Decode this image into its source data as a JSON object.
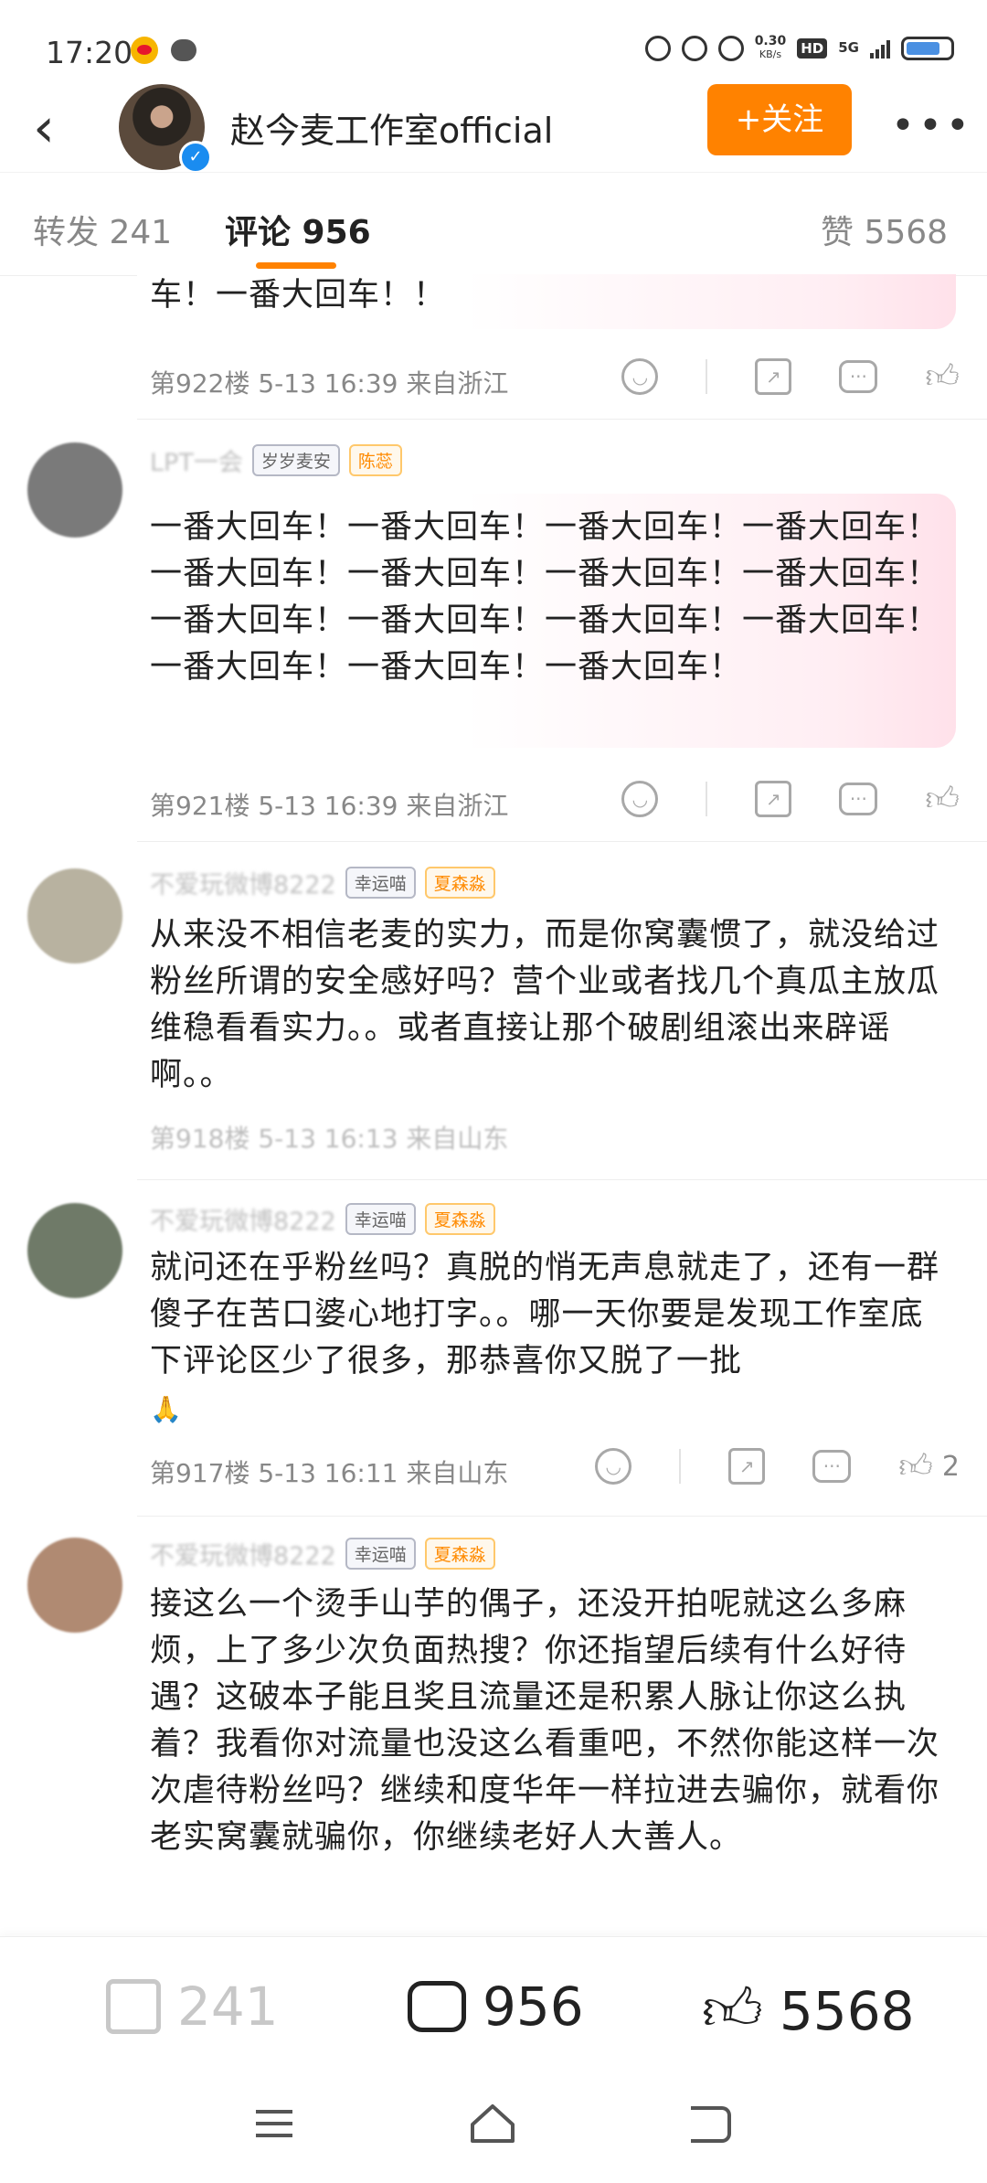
{
  "status_bar": {
    "time": "17:20",
    "net_speed_value": "0.30",
    "net_speed_unit": "KB/s",
    "hd": "HD",
    "network": "5G"
  },
  "header": {
    "back_icon": "chevron-left-icon",
    "title": "赵今麦工作室official",
    "follow_label": "+关注",
    "more_label": "•••"
  },
  "tabs": {
    "repost": "转发 241",
    "comments": "评论 956",
    "likes": "赞 5568"
  },
  "comments": [
    {
      "text": "车！一番大回车！！",
      "meta": "第922楼 5-13 16:39 来自浙江"
    },
    {
      "name": "LPT一会",
      "badge1": "岁岁麦安",
      "badge2": "陈蕊",
      "text": "一番大回车！一番大回车！一番大回车！一番大回车！一番大回车！一番大回车！一番大回车！一番大回车！一番大回车！一番大回车！一番大回车！一番大回车！一番大回车！一番大回车！一番大回车！",
      "meta": "第921楼 5-13 16:39 来自浙江"
    },
    {
      "name": "不爱玩微博8222",
      "badge1": "幸运喵",
      "badge2": "夏森淼",
      "text": "从来没不相信老麦的实力，而是你窝囊惯了，就没给过粉丝所谓的安全感好吗？营个业或者找几个真瓜主放瓜维稳看看实力。。或者直接让那个破剧组滚出来辟谣啊。。",
      "meta": "第918楼 5-13 16:13 来自山东"
    },
    {
      "name": "不爱玩微博8222",
      "badge1": "幸运喵",
      "badge2": "夏森淼",
      "text": "就问还在乎粉丝吗？真脱的悄无声息就走了，还有一群傻子在苦口婆心地打字。。哪一天你要是发现工作室底下评论区少了很多，那恭喜你又脱了一批",
      "emoji": "🙏",
      "meta": "第917楼 5-13 16:11 来自山东",
      "likes": "2"
    },
    {
      "name": "不爱玩微博8222",
      "badge1": "幸运喵",
      "badge2": "夏森淼",
      "text": "接这么一个烫手山芋的偶子，还没开拍呢就这么多麻烦，上了多少次负面热搜？你还指望后续有什么好待遇？这破本子能且奖且流量还是积累人脉让你这么执着？我看你对流量也没这么看重吧，不然你能这样一次次虐待粉丝吗？继续和度华年一样拉进去骗你，就看你老实窝囊就骗你，你继续老好人大善人。"
    }
  ],
  "bottom_bar": {
    "reposts": "241",
    "comments": "956",
    "likes": "5568"
  },
  "colors": {
    "accent": "#ff8200",
    "text_primary": "#222222",
    "text_secondary": "#888888",
    "verified": "#1a8cf0"
  }
}
